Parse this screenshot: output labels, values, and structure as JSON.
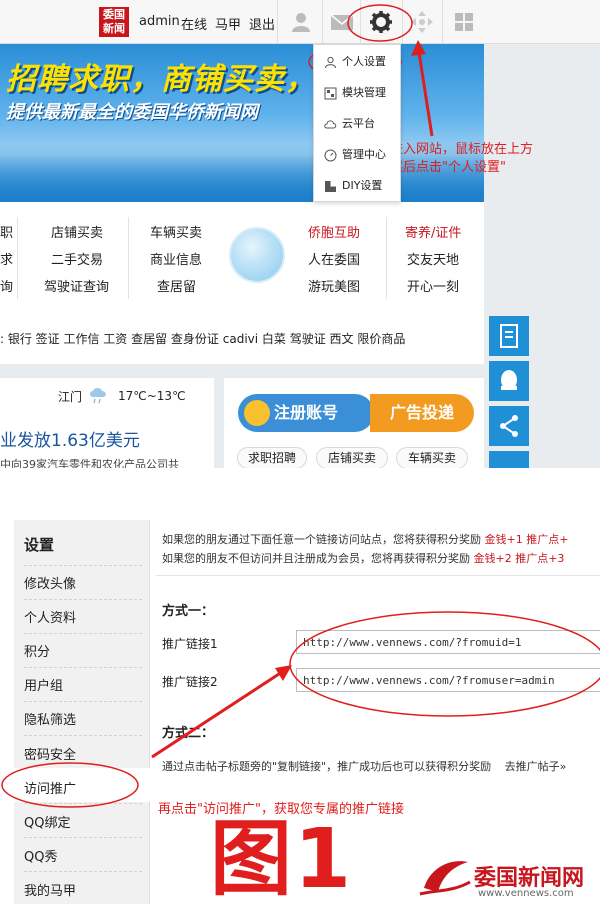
{
  "topbar": {
    "logo_text": "委国新闻",
    "username": "admin",
    "online": "在线",
    "horse": "马甲",
    "logout": "退出"
  },
  "banner": {
    "line1": "招聘求职，商铺买卖，互助!",
    "line2": "提供最新最全的委国华侨新闻网"
  },
  "dropdown": {
    "items": [
      "个人设置",
      "模块管理",
      "云平台",
      "管理中心",
      "DIY设置"
    ]
  },
  "nav": {
    "col1": [
      "职",
      "求",
      "询"
    ],
    "col2": [
      "店铺买卖",
      "二手交易",
      "驾驶证查询"
    ],
    "col3": [
      "车辆买卖",
      "商业信息",
      "查居留"
    ],
    "col4": [
      "侨胞互助",
      "人在委国",
      "游玩美图"
    ],
    "col5": [
      "寄养/证件",
      "交友天地",
      "开心一刻"
    ]
  },
  "tags": ": 银行  签证  工作信  工资  查居留  查身份证  cadivi  白菜  驾驶证  西文  限价商品",
  "weather": {
    "city": "江门",
    "temp": "17℃~13℃"
  },
  "news": {
    "headline": "业发放1.63亿美元",
    "subline": "中向39家汽车零件和农化产品公司共"
  },
  "register": {
    "register_label": "注册账号",
    "ad_label": "广告投递",
    "pills": [
      "求职招聘",
      "店铺买卖",
      "车辆买卖"
    ]
  },
  "settings": {
    "title": "设置",
    "items": [
      "修改头像",
      "个人资料",
      "积分",
      "用户组",
      "隐私筛选",
      "密码安全",
      "访问推广",
      "QQ绑定",
      "QQ秀",
      "我的马甲"
    ]
  },
  "promo": {
    "line1_a": "如果您的朋友通过下面任意一个链接访问站点，您将获得积分奖励",
    "line1_b": "金钱+1 推广点+",
    "line2_a": "如果您的朋友不但访问并且注册成为会员，您将再获得积分奖励",
    "line2_b": "金钱+2 推广点+3",
    "method1": "方式一：",
    "link1_label": "推广链接1",
    "link1_value": "http://www.vennews.com/?fromuid=1",
    "link2_label": "推广链接2",
    "link2_value": "http://www.vennews.com/?fromuser=admin",
    "method2": "方式二：",
    "method2_text": "通过点击帖子标题旁的\"复制链接\"，推广成功后也可以获得积分奖励",
    "method2_link": "去推广帖子»"
  },
  "annotations": {
    "top_note_1": "进入网站，鼠标放在上方",
    "top_note_2": "然后点击\"个人设置\"",
    "bottom_note": "再点击\"访问推广\"，获取您专属的推广链接",
    "figure": "图1",
    "annotation_color": "#e01e1e"
  },
  "watermark": {
    "name": "委国新闻网",
    "url": "www.vennews.com"
  },
  "colors": {
    "brand_red": "#c8161d",
    "side_blue": "#1f8fd6",
    "register_blue": "#3a8fd6",
    "ad_orange": "#f39a21"
  }
}
